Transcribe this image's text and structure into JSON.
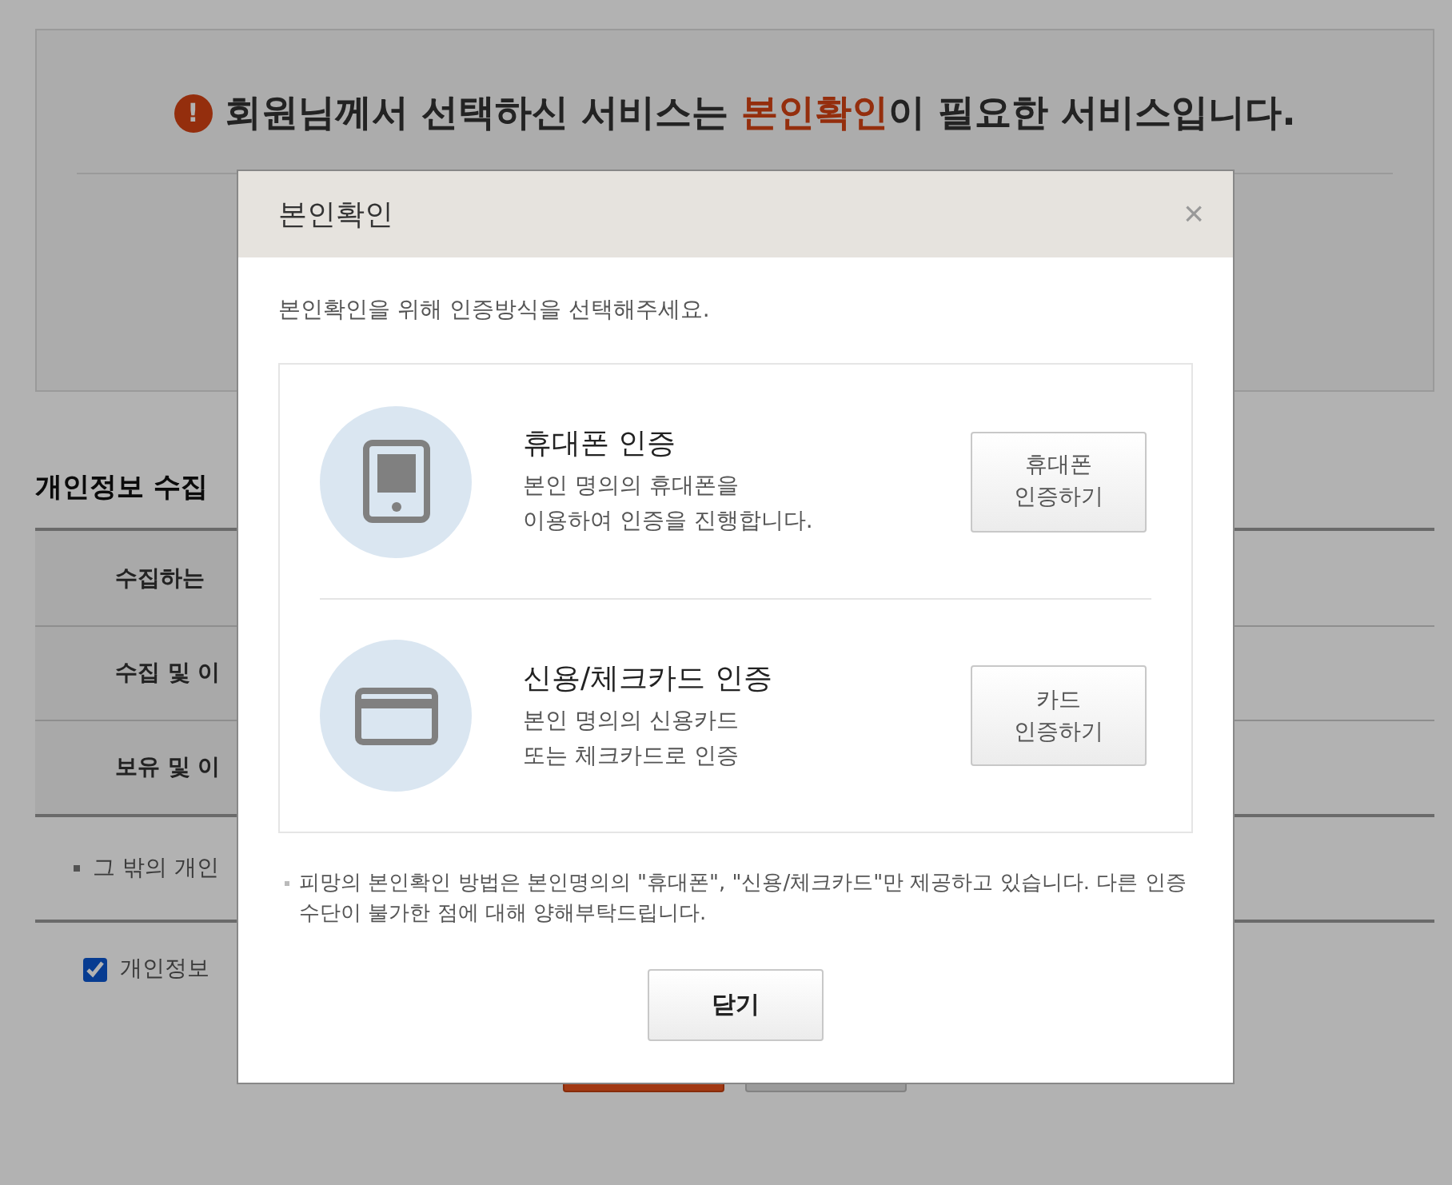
{
  "page": {
    "notice": {
      "icon": "!",
      "before": "회원님께서 선택하신 서비스는 ",
      "highlight": "본인확인",
      "after": "이 필요한 서비스입니다."
    },
    "section_title": "개인정보 수집",
    "table_rows": [
      "수집하는",
      "수집 및 이",
      "보유 및 이"
    ],
    "note": "그 밖의 개인",
    "consent": {
      "label": "개인정보",
      "checked": true
    },
    "buttons": [
      {
        "kind": "primary"
      },
      {
        "kind": "secondary"
      }
    ]
  },
  "modal": {
    "title": "본인확인",
    "close": "×",
    "intro": "본인확인을 위해 인증방식을 선택해주세요.",
    "methods": [
      {
        "kind": "phone",
        "title": "휴대폰 인증",
        "description": [
          "본인 명의의 휴대폰을",
          "이용하여 인증을 진행합니다."
        ],
        "button": [
          "휴대폰",
          "인증하기"
        ]
      },
      {
        "kind": "card",
        "title": "신용/체크카드 인증",
        "description": [
          "본인 명의의 신용카드",
          "또는 체크카드로 인증"
        ],
        "button": [
          "카드",
          "인증하기"
        ]
      }
    ],
    "note": "피망의 본인확인 방법은 본인명의의 \"휴대폰\", \"신용/체크카드\"만 제공하고 있습니다. 다른 인증 수단이 불가한 점에 대해 양해부탁드립니다.",
    "close_button": "닫기"
  }
}
